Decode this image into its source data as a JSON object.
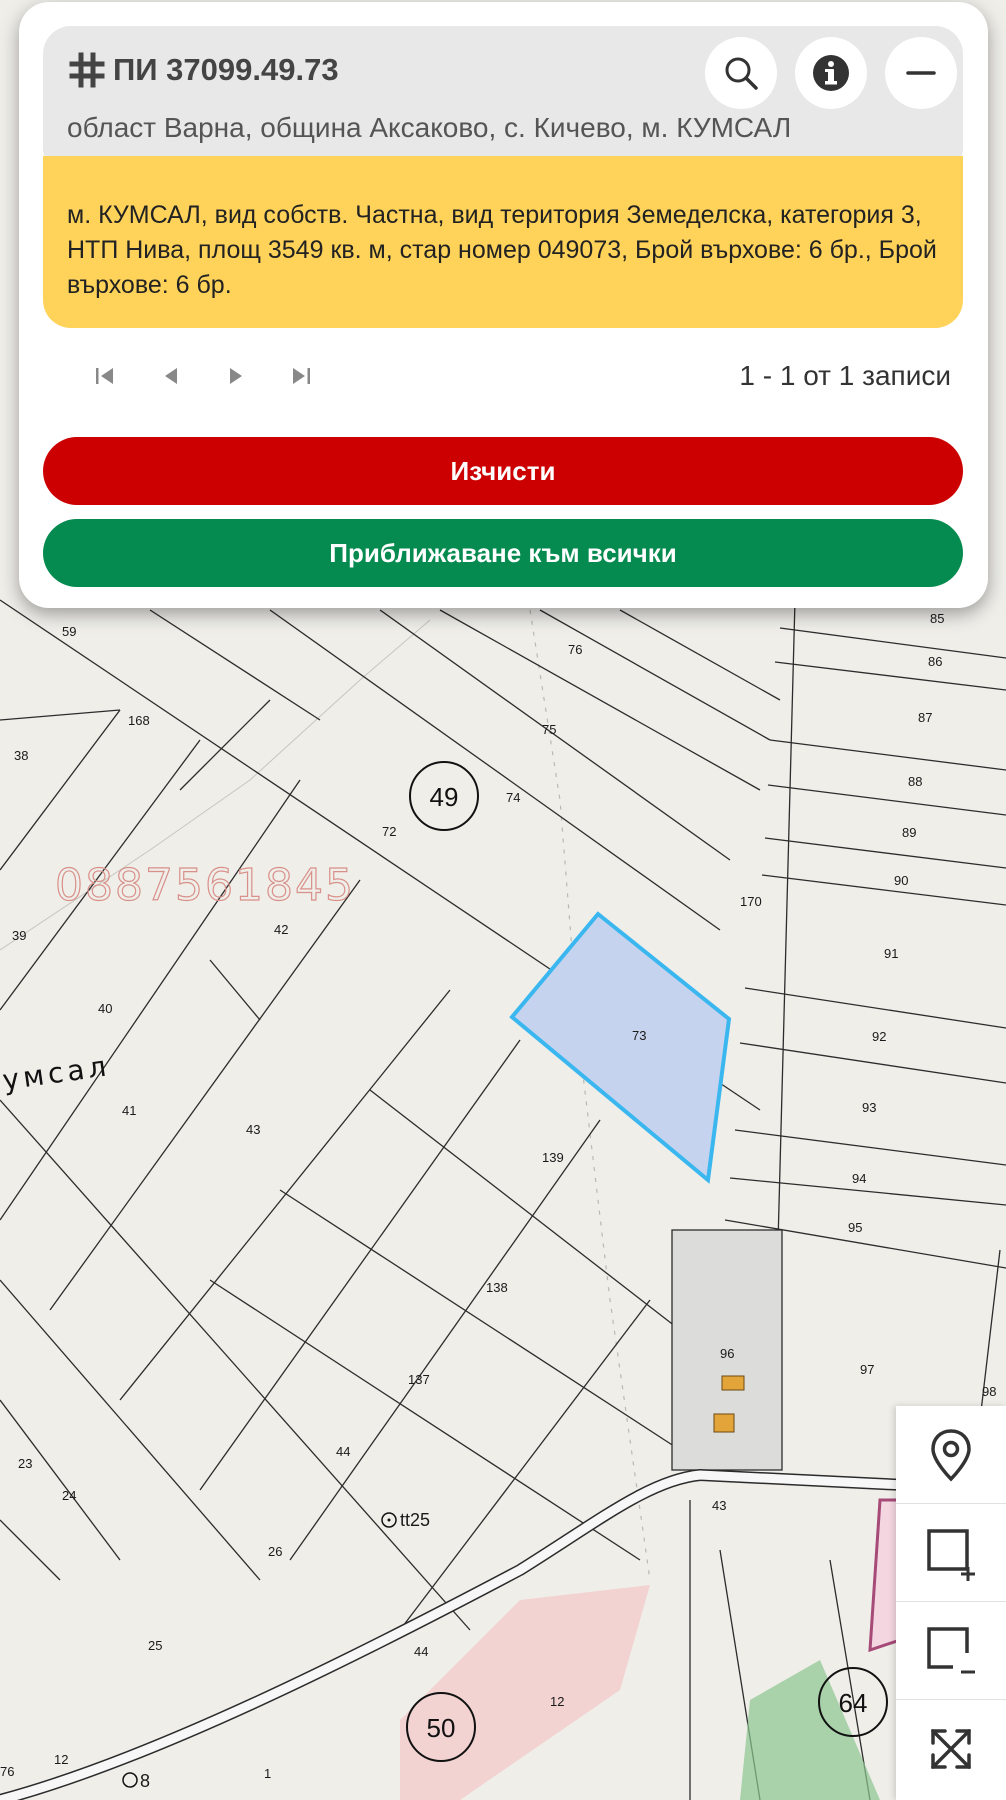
{
  "card": {
    "title": "ПИ 37099.49.73",
    "subtitle": "област Варна, община Аксаково, с. Кичево, м. КУМСАЛ",
    "description": "м. КУМСАЛ, вид собств. Частна, вид територия Земеделска, категория 3, НТП Нива, площ 3549 кв. м, стар номер 049073, Брой върхове: 6 бр., Брой върхове: 6 бр.",
    "pager_count": "1 - 1 от 1 записи",
    "clear_label": "Изчисти",
    "zoom_all_label": "Приближаване към всички",
    "icons": {
      "title": "grid-hash-icon",
      "search": "search-icon",
      "info": "info-icon",
      "minimize": "minimize-icon",
      "first": "first-page-icon",
      "prev": "prev-page-icon",
      "next": "next-page-icon",
      "last": "last-page-icon"
    }
  },
  "map": {
    "watermark": "0887561845",
    "locality": "умсал",
    "sheets": [
      "49",
      "50",
      "64"
    ],
    "parcel_labels": [
      "85",
      "86",
      "87",
      "88",
      "89",
      "90",
      "91",
      "92",
      "93",
      "94",
      "95",
      "96",
      "97",
      "98",
      "76",
      "75",
      "74",
      "72",
      "73",
      "170",
      "42",
      "39",
      "38",
      "40",
      "41",
      "43",
      "168",
      "59",
      "139",
      "138",
      "137",
      "44",
      "24",
      "23",
      "26",
      "25",
      "12",
      "1",
      "12",
      "76",
      "43",
      "44",
      "tt25",
      "8"
    ],
    "highlight_color": "#3bb7f0",
    "highlight_fill": "#c6d3ee"
  },
  "tools": {
    "icons": [
      "location-pin-icon",
      "select-add-icon",
      "select-remove-icon",
      "fullscreen-icon"
    ]
  },
  "colors": {
    "accent_yellow": "#ffd35a",
    "clear_red": "#cc0000",
    "zoom_green": "#058a4f"
  }
}
